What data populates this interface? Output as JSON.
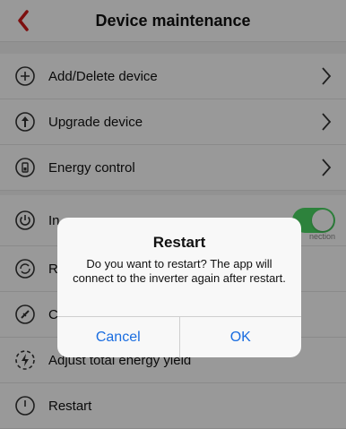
{
  "header": {
    "title": "Device maintenance"
  },
  "menu": {
    "items": [
      {
        "label": "Add/Delete device",
        "icon": "plus-circle-icon"
      },
      {
        "label": "Upgrade device",
        "icon": "upgrade-arrow-icon"
      },
      {
        "label": "Energy control",
        "icon": "battery-icon"
      }
    ],
    "lower": [
      {
        "label": "In",
        "icon": "power-icon",
        "status": "nection"
      },
      {
        "label": "R",
        "icon": "refresh-icon"
      },
      {
        "label": "C",
        "icon": "plug-icon"
      },
      {
        "label": "Adjust total energy yield",
        "icon": "lightning-icon"
      },
      {
        "label": "Restart",
        "icon": "power-off-icon"
      }
    ]
  },
  "dialog": {
    "title": "Restart",
    "message": "Do you want to restart? The app will connect to the inverter again after restart.",
    "cancel_label": "Cancel",
    "ok_label": "OK"
  },
  "colors": {
    "accent": "#1a6de0",
    "back_arrow": "#d0191a",
    "toggle_on": "#4cd964"
  }
}
